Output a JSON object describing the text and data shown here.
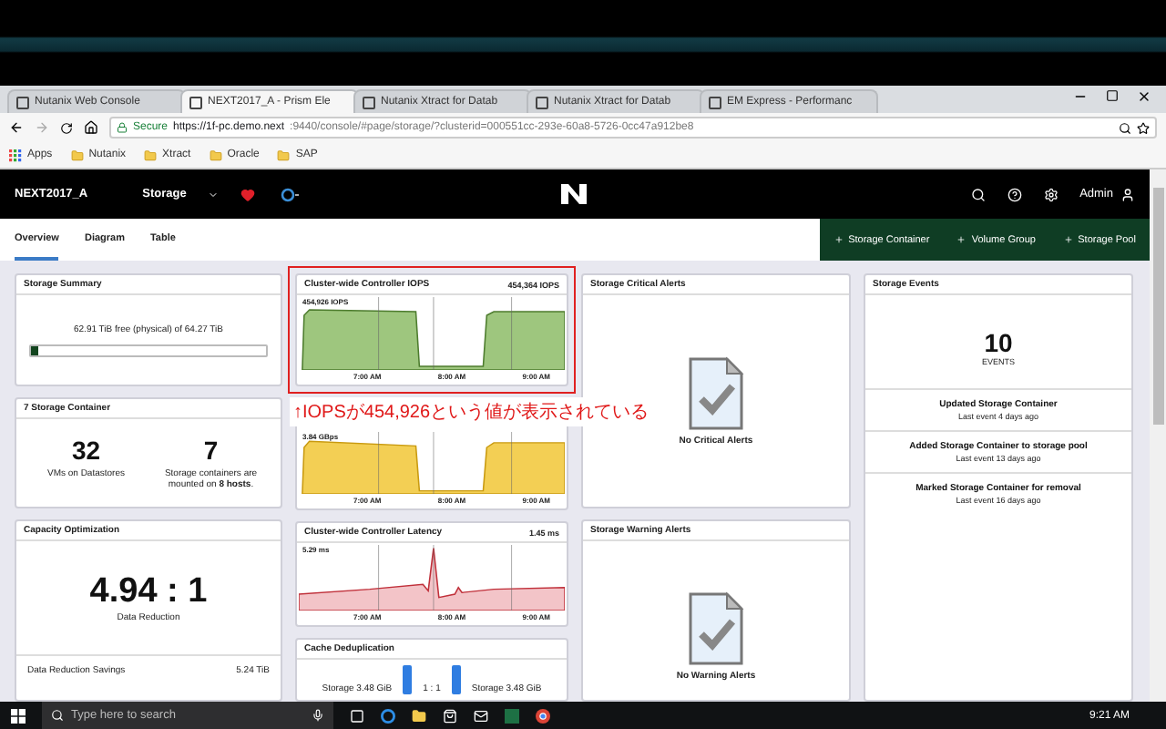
{
  "browser": {
    "tabs": [
      {
        "title": "Nutanix Web Console",
        "selected": false
      },
      {
        "title": "NEXT2017_A - Prism Ele",
        "selected": true
      },
      {
        "title": "Nutanix Xtract for Datab",
        "selected": false
      },
      {
        "title": "Nutanix Xtract for Datab",
        "selected": false
      },
      {
        "title": "EM Express - Performanc",
        "selected": false
      }
    ],
    "security_label": "Secure",
    "url_host": "https://1f-pc.demo.next",
    "url_rest": ":9440/console/#page/storage/?clusterid=000551cc-293e-60a8-5726-0cc47a912be8",
    "bookmarks": [
      {
        "label": "Apps",
        "kind": "apps"
      },
      {
        "label": "Nutanix",
        "kind": "folder"
      },
      {
        "label": "Xtract",
        "kind": "folder"
      },
      {
        "label": "Oracle",
        "kind": "folder"
      },
      {
        "label": "SAP",
        "kind": "folder"
      }
    ]
  },
  "header": {
    "cluster": "NEXT2017_A",
    "section": "Storage",
    "user": "Admin"
  },
  "subnav": {
    "tabs": [
      {
        "label": "Overview",
        "selected": true
      },
      {
        "label": "Diagram",
        "selected": false
      },
      {
        "label": "Table",
        "selected": false
      }
    ],
    "actions": [
      "Storage Container",
      "Volume Group",
      "Storage Pool"
    ]
  },
  "summary": {
    "title": "Storage Summary",
    "text": "62.91 TiB free (physical) of 64.27 TiB",
    "level": 0.03
  },
  "containers": {
    "title": "7 Storage Container",
    "stats": [
      {
        "value": "32",
        "label": "VMs on Datastores"
      },
      {
        "value": "7",
        "label": "Storage containers are mounted on **8 hosts**."
      }
    ]
  },
  "capacity": {
    "title": "Capacity Optimization",
    "ratio": "4.94 : 1",
    "caption": "Data Reduction",
    "row_label": "Data Reduction Savings",
    "row_value": "5.24 TiB"
  },
  "iops": {
    "title": "Cluster-wide Controller IOPS",
    "value": "454,364 IOPS",
    "peak": "454,926 IOPS",
    "kind": "iops",
    "times": [
      "7:00 AM",
      "8:00 AM",
      "9:00 AM"
    ]
  },
  "annotation": "↑IOPSが454,926という値が表示されている",
  "bandwidth": {
    "peak": "3.84 GBps",
    "kind": "bandwidth",
    "times": [
      "7:00 AM",
      "8:00 AM",
      "9:00 AM"
    ]
  },
  "latency": {
    "title": "Cluster-wide Controller Latency",
    "value": "1.45 ms",
    "peak": "5.29 ms",
    "kind": "latency",
    "times": [
      "7:00 AM",
      "8:00 AM",
      "9:00 AM"
    ]
  },
  "dedup": {
    "title": "Cache Deduplication",
    "left": "Storage 3.48 GiB",
    "ratio": "1 : 1",
    "right": "Storage 3.48 GiB"
  },
  "critical": {
    "title": "Storage Critical Alerts",
    "empty": "No Critical Alerts"
  },
  "warning": {
    "title": "Storage Warning Alerts",
    "empty": "No Warning Alerts"
  },
  "events": {
    "title": "Storage Events",
    "count": "10",
    "count_label": "EVENTS",
    "items": [
      {
        "title": "Updated Storage Container",
        "time": "Last event 4 days ago"
      },
      {
        "title": "Added Storage Container to storage pool",
        "time": "Last event 13 days ago"
      },
      {
        "title": "Marked Storage Container for removal",
        "time": "Last event 16 days ago"
      }
    ]
  },
  "taskbar": {
    "search_placeholder": "Type here to search",
    "time": "9:21 AM"
  }
}
